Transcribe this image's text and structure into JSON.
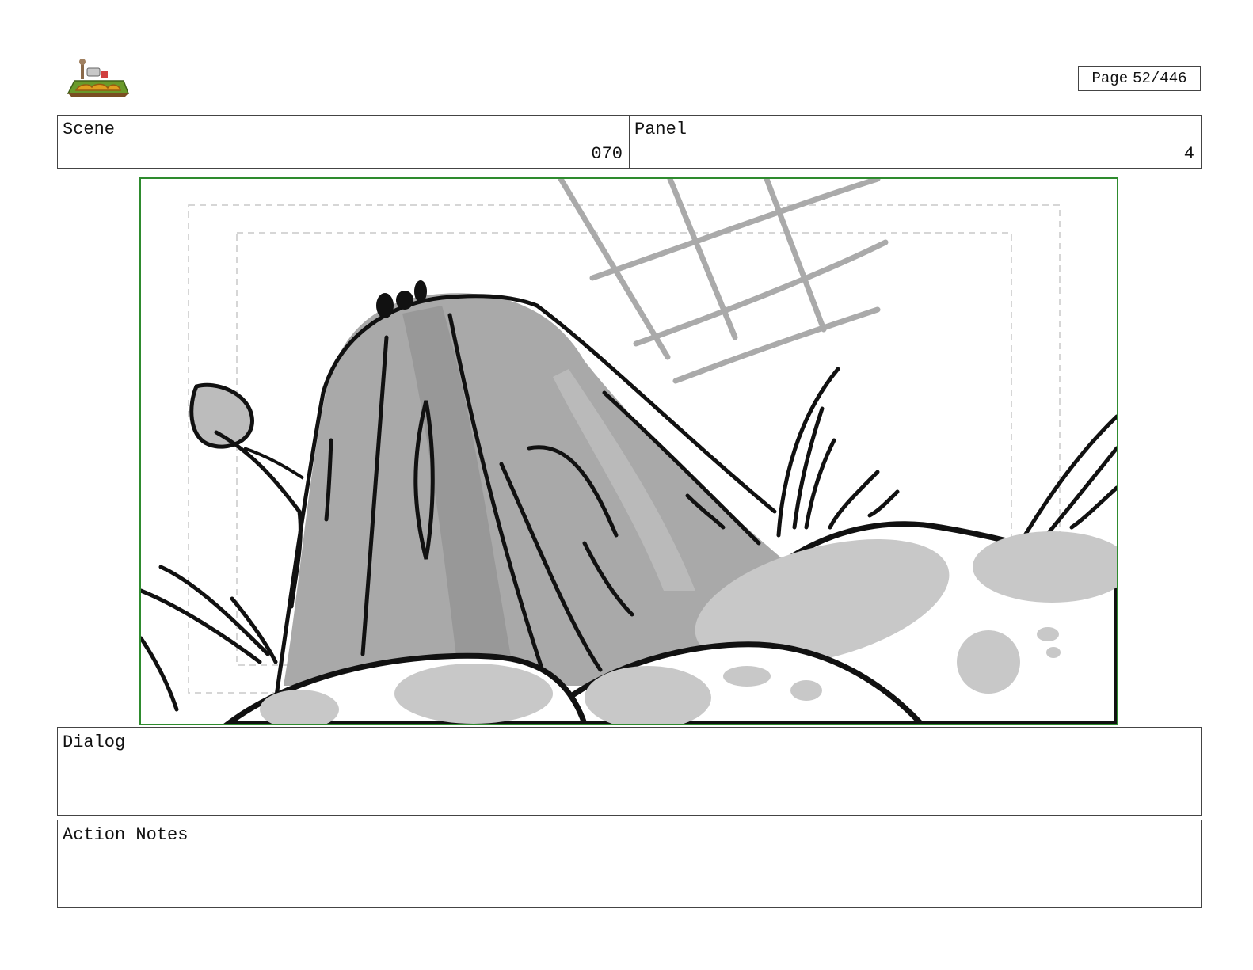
{
  "logo": {
    "icon": "show-logo-icon"
  },
  "page": {
    "label": "Page",
    "value": "52/446"
  },
  "header": {
    "scene_label": "Scene",
    "scene_value": "070",
    "panel_label": "Panel",
    "panel_value": "4"
  },
  "frame": {
    "content": "storyboard-sketch",
    "border_color": "#2e8b2e"
  },
  "dialog": {
    "label": "Dialog",
    "text": ""
  },
  "action_notes": {
    "label": "Action Notes",
    "text": ""
  }
}
